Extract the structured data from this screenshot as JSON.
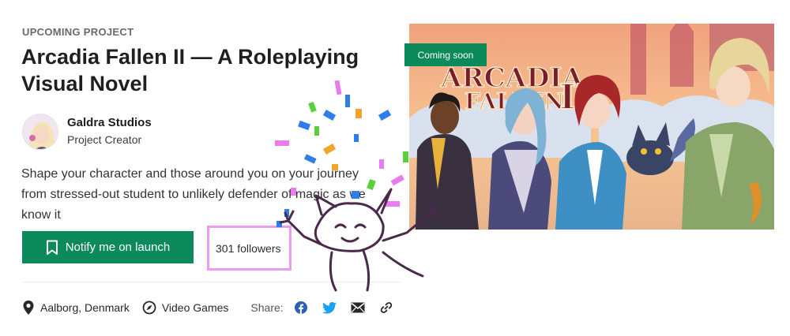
{
  "project": {
    "eyebrow": "UPCOMING PROJECT",
    "title": "Arcadia Fallen II — A Roleplaying Visual Novel",
    "description": "Shape your character and those around you on your journey from stressed-out student to unlikely defender of magic as we know it"
  },
  "creator": {
    "name": "Galdra Studios",
    "role": "Project Creator"
  },
  "actions": {
    "notify_label": "Notify me on launch",
    "followers": "301 followers"
  },
  "meta": {
    "location": "Aalborg, Denmark",
    "category": "Video Games",
    "share_label": "Share:",
    "share_icons": [
      "facebook-icon",
      "twitter-icon",
      "email-icon",
      "link-icon"
    ]
  },
  "hero": {
    "badge": "Coming soon",
    "logo_text": "Arcadia Fallen II"
  },
  "colors": {
    "accent": "#0c8a5b",
    "highlight": "#ea9df0",
    "facebook": "#1877f2",
    "twitter": "#1da1f2"
  }
}
